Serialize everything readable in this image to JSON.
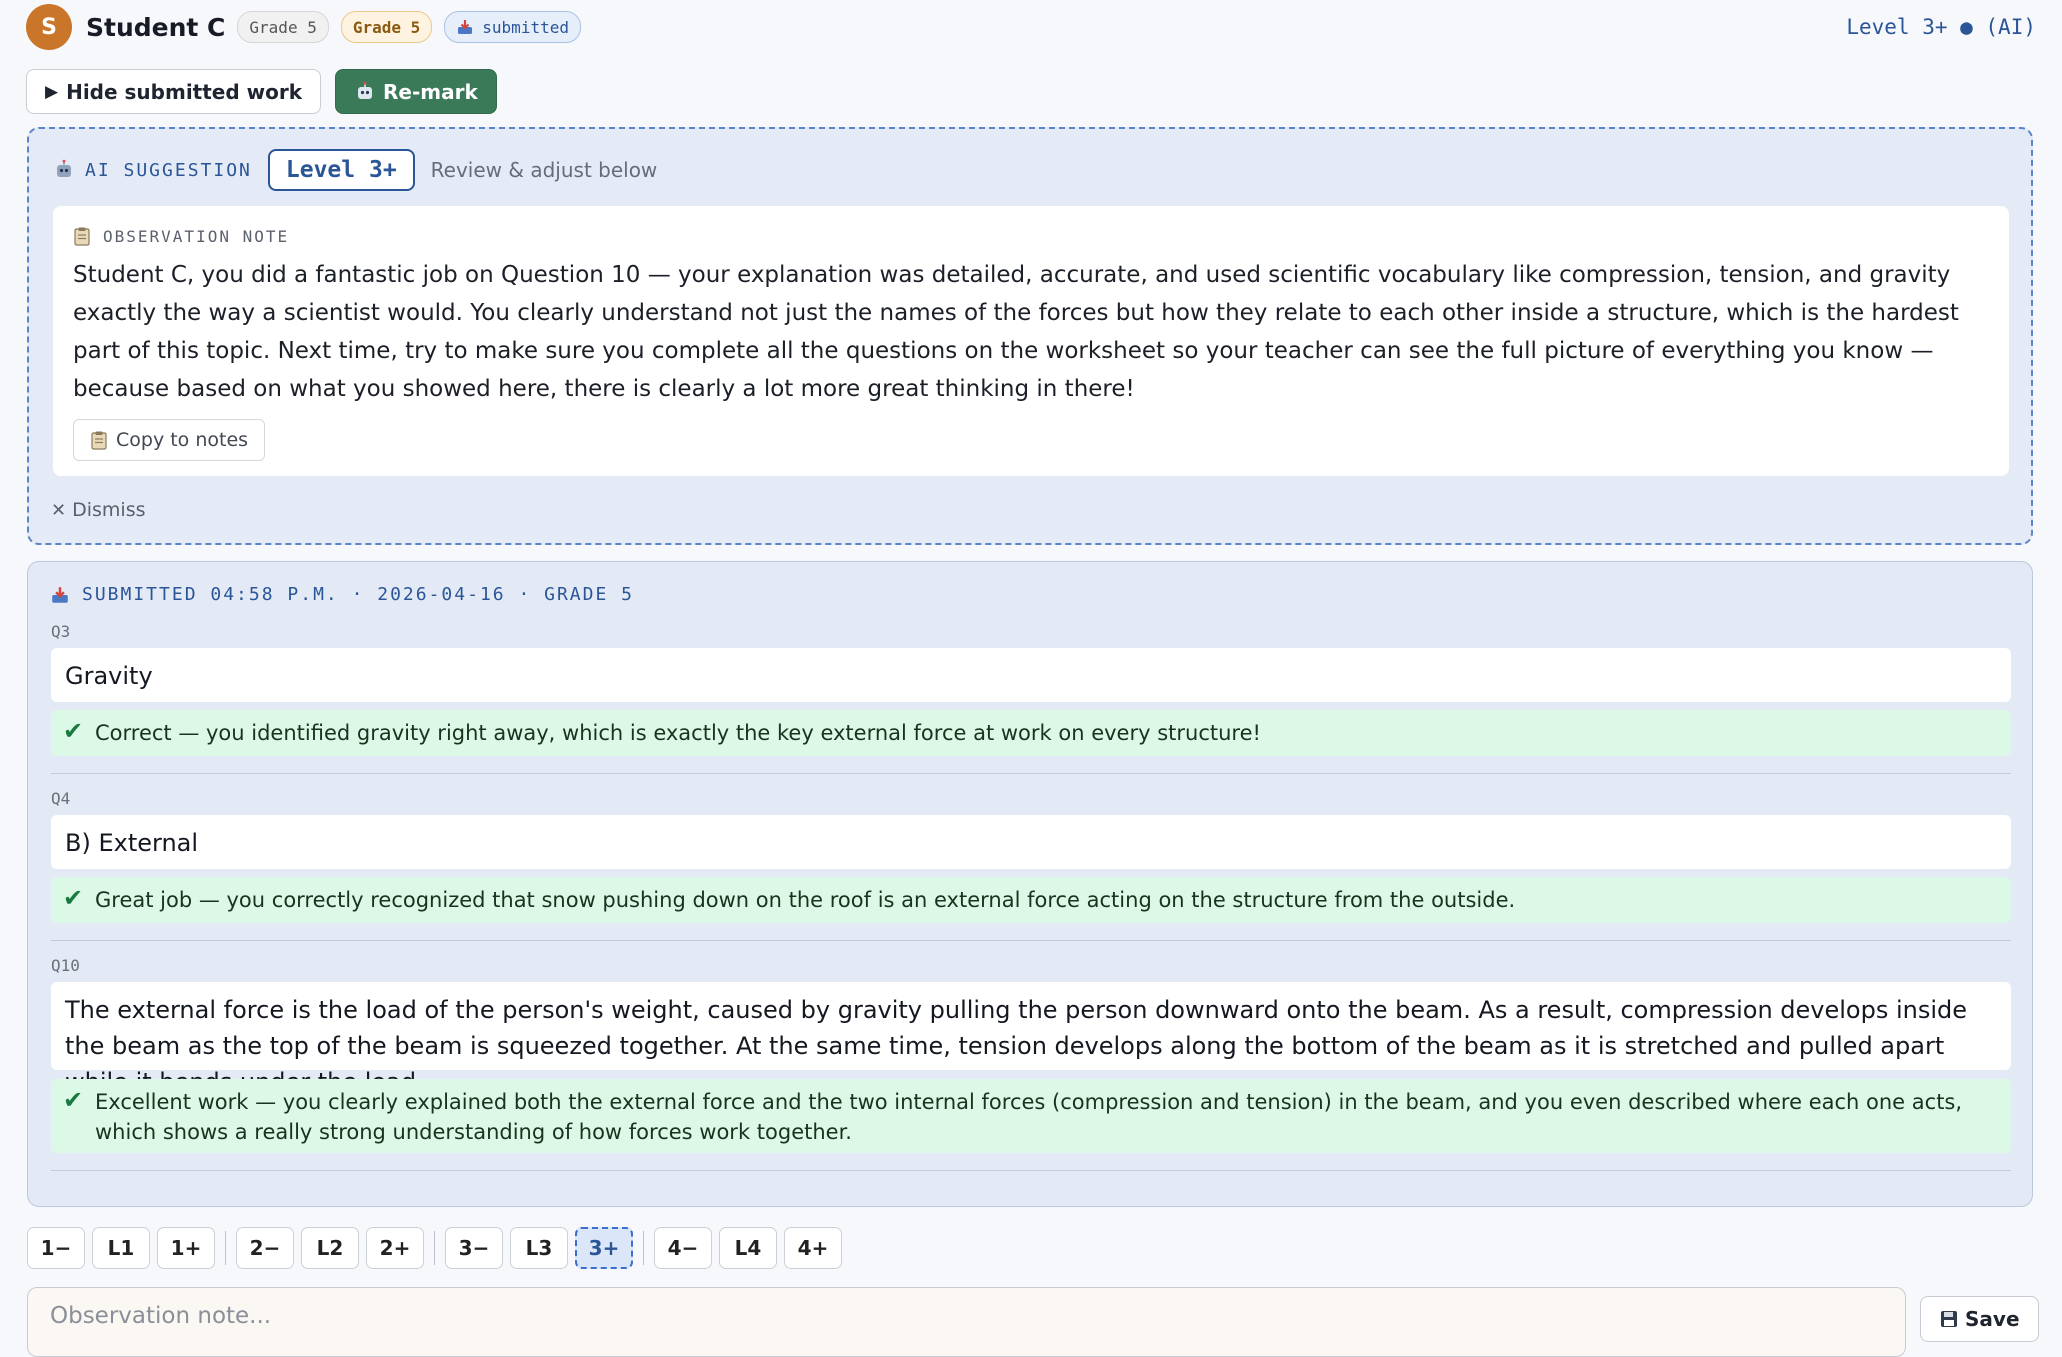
{
  "header": {
    "avatar_initial": "S",
    "student_name": "Student C",
    "grade_badge_1": "Grade 5",
    "grade_badge_2": "Grade 5",
    "status_badge": "submitted",
    "level_indicator": "Level 3+ ● (AI)"
  },
  "toolbar": {
    "hide_label": "Hide submitted work",
    "remark_label": "Re-mark"
  },
  "ai_suggestion": {
    "label": "AI SUGGESTION",
    "level": "Level 3+",
    "hint": "Review & adjust below",
    "note_title": "OBSERVATION NOTE",
    "note_text": "Student C, you did a fantastic job on Question 10 — your explanation was detailed, accurate, and used scientific vocabulary like compression, tension, and gravity exactly the way a scientist would. You clearly understand not just the names of the forces but how they relate to each other inside a structure, which is the hardest part of this topic. Next time, try to make sure you complete all the questions on the worksheet so your teacher can see the full picture of everything you know — because based on what you showed here, there is clearly a lot more great thinking in there!",
    "copy_label": "Copy to notes",
    "dismiss_label": "Dismiss"
  },
  "submission": {
    "header": "SUBMITTED 04:58 P.M. · 2026-04-16 · GRADE 5",
    "questions": [
      {
        "label": "Q3",
        "answer": "Gravity",
        "feedback": "Correct — you identified gravity right away, which is exactly the key external force at work on every structure!"
      },
      {
        "label": "Q4",
        "answer": "B) External",
        "feedback": "Great job — you correctly recognized that snow pushing down on the roof is an external force acting on the structure from the outside."
      },
      {
        "label": "Q10",
        "answer": "The external force is the load of the person's weight, caused by gravity pulling the person downward onto the beam. As a result, compression develops inside the beam as the top of the beam is squeezed together. At the same time, tension develops along the bottom of the beam as it is stretched and pulled apart while it bends under the load.",
        "feedback": "Excellent work — you clearly explained both the external force and the two internal forces (compression and tension) in the beam, and you even described where each one acts, which shows a really strong understanding of how forces work together."
      }
    ]
  },
  "levels": [
    "1−",
    "L1",
    "1+",
    "2−",
    "L2",
    "2+",
    "3−",
    "L3",
    "3+",
    "4−",
    "L4",
    "4+"
  ],
  "selected_level": "3+",
  "note_input": {
    "placeholder": "Observation note...",
    "value": ""
  },
  "save_label": "Save",
  "icons": {
    "check": "✔",
    "dismiss": "✕",
    "play": "▶"
  },
  "colors": {
    "accent": "#2a5597",
    "remark_button": "#3a7a58",
    "avatar": "#c9762a",
    "feedback_bg": "#dcf8e6"
  }
}
